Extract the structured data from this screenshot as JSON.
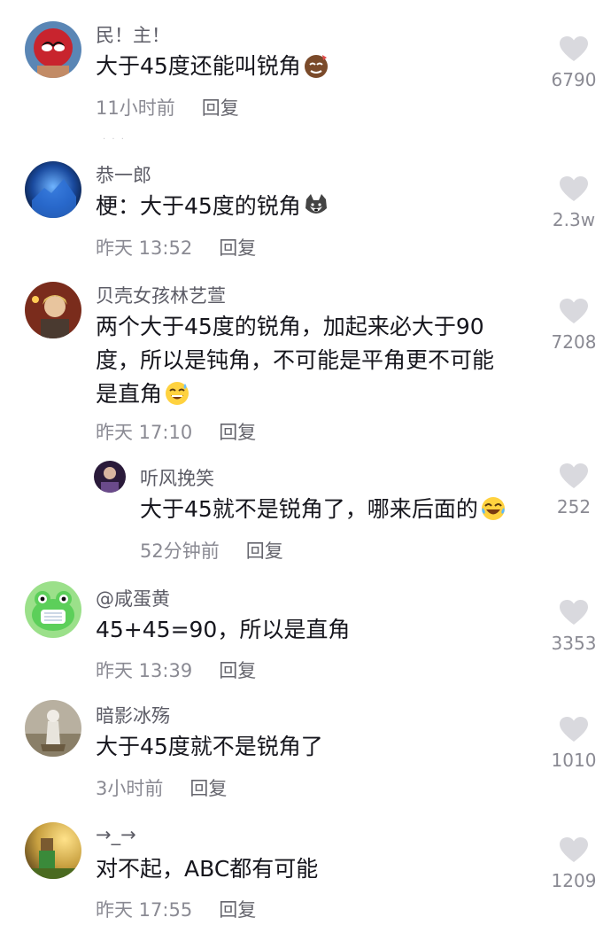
{
  "comments": [
    {
      "name": "民！主！",
      "text": "大于45度还能叫锐角",
      "time": "11小时前",
      "reply": "回复",
      "likes": "6790",
      "emoji": "sly-face-icon"
    },
    {
      "name": "恭一郎",
      "text": "梗：大于45度的锐角",
      "time": "昨天 13:52",
      "reply": "回复",
      "likes": "2.3w",
      "emoji": "husky-face-icon"
    },
    {
      "name": "贝壳女孩林艺萱",
      "text_lines": [
        "两个大于45度的锐角，加起来必大于90",
        "度，所以是钝角，不可能是平角更不可能",
        "是直角"
      ],
      "time": "昨天 17:10",
      "reply": "回复",
      "likes": "7208",
      "emoji": "sweat-smile-icon"
    },
    {
      "name": "听风挽笑",
      "text": "大于45就不是锐角了，哪来后面的",
      "time": "52分钟前",
      "reply": "回复",
      "likes": "252",
      "emoji": "tears-of-joy-icon"
    },
    {
      "name": "@咸蛋黄",
      "text": "45+45=90，所以是直角",
      "time": "昨天 13:39",
      "reply": "回复",
      "likes": "3353"
    },
    {
      "name": "暗影冰殇",
      "text": "大于45度就不是锐角了",
      "time": "3小时前",
      "reply": "回复",
      "likes": "1010"
    },
    {
      "name": "→_→",
      "text": "对不起，ABC都有可能",
      "time": "昨天 17:55",
      "reply": "回复",
      "likes": "1209"
    }
  ],
  "colors": {
    "like_icon": "#d9d9de",
    "name": "#5c5c66",
    "text": "#16161d",
    "meta": "#8a8a93"
  }
}
